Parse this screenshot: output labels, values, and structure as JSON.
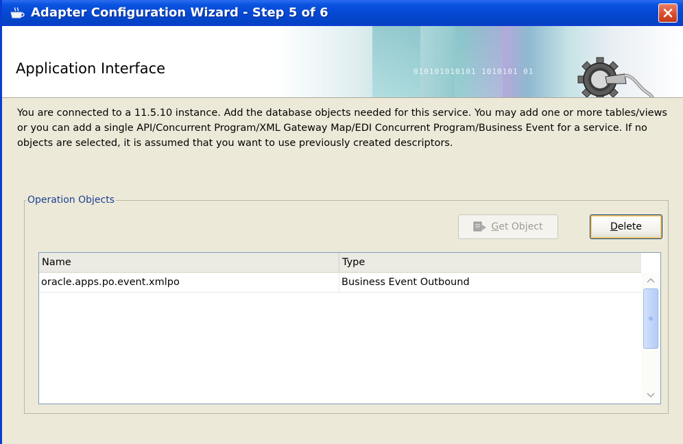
{
  "window": {
    "title": "Adapter Configuration Wizard - Step 5 of 6",
    "close_icon": "close-icon"
  },
  "banner": {
    "title": "Application Interface",
    "digits": "010101010101 1010101 01",
    "icon": "gear-plug-icon"
  },
  "description": "You are connected to a 11.5.10 instance. Add the database objects needed for this service. You may add one or more tables/views or you can add a single API/Concurrent Program/XML Gateway Map/EDI Concurrent Program/Business Event for a service. If no objects are selected, it is assumed that you want to use previously created descriptors.",
  "operation_objects": {
    "legend": "Operation Objects",
    "buttons": {
      "get_object": {
        "label": "Get Object",
        "mnemonic": "G",
        "rest": "et Object",
        "enabled": false,
        "icon": "get-object-icon"
      },
      "delete": {
        "label": "Delete",
        "mnemonic": "D",
        "rest": "elete",
        "enabled": true
      }
    },
    "table": {
      "columns": [
        "Name",
        "Type"
      ],
      "rows": [
        {
          "name": "oracle.apps.po.event.xmlpo",
          "type": "Business Event Outbound"
        }
      ]
    }
  }
}
